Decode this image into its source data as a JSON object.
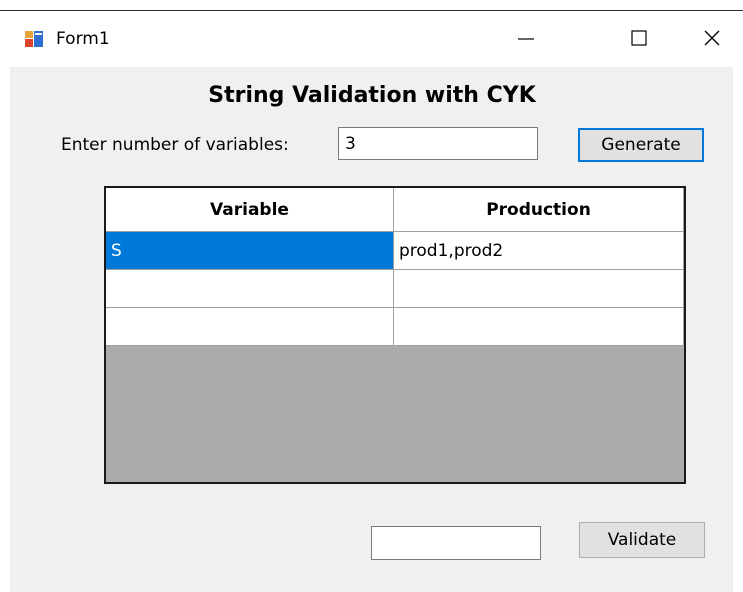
{
  "window": {
    "title": "Form1",
    "icon": "winforms-app-icon"
  },
  "titlebar_buttons": [
    {
      "name": "minimize",
      "icon": "minimize-icon"
    },
    {
      "name": "maximize",
      "icon": "maximize-icon"
    },
    {
      "name": "close",
      "icon": "close-icon"
    }
  ],
  "form": {
    "heading": "String Validation with CYK",
    "variables_label": "Enter number of variables:",
    "variables_value": "3",
    "generate_label": "Generate",
    "string_value": "",
    "validate_label": "Validate"
  },
  "grid": {
    "columns": [
      "Variable",
      "Production"
    ],
    "rows": [
      [
        "S",
        "prod1,prod2"
      ],
      [
        "",
        ""
      ],
      [
        "",
        ""
      ]
    ],
    "selected_cell": "row 1, Variable"
  },
  "colors": {
    "selection": "#0078d7",
    "client_background": "#f0f0f0",
    "grid_background": "#ababab",
    "focus_border": "#0078d7"
  }
}
